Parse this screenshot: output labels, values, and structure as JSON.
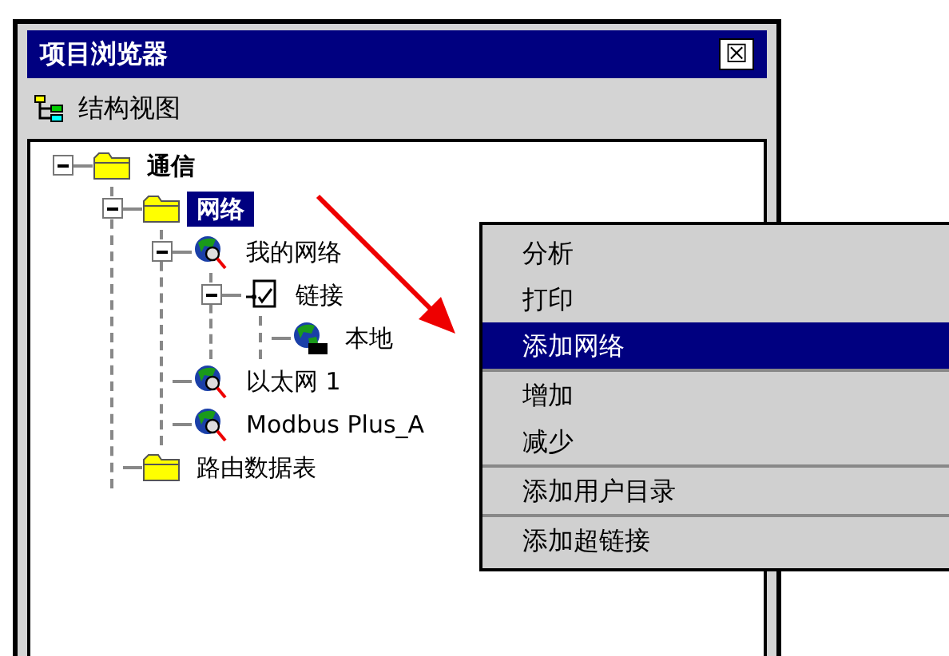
{
  "window": {
    "title": "项目浏览器",
    "close": "☒"
  },
  "toolbar": {
    "label": "结构视图"
  },
  "tree": [
    {
      "label": "通信",
      "kind": "folder",
      "expanded": true,
      "selected": false,
      "children": [
        {
          "label": "网络",
          "kind": "folder",
          "expanded": true,
          "selected": true,
          "children": [
            {
              "label": "我的网络",
              "kind": "network",
              "expanded": true,
              "selected": false,
              "children": [
                {
                  "label": "链接",
                  "kind": "link",
                  "expanded": true,
                  "selected": false,
                  "children": [
                    {
                      "label": "本地",
                      "kind": "local",
                      "selected": false
                    }
                  ]
                }
              ]
            },
            {
              "label": "以太网 1",
              "kind": "network",
              "selected": false
            },
            {
              "label": "Modbus Plus_A",
              "kind": "network",
              "selected": false
            }
          ]
        },
        {
          "label": "路由数据表",
          "kind": "folder",
          "selected": false
        }
      ]
    }
  ],
  "context_menu": {
    "groups": [
      [
        {
          "label": "分析",
          "selected": false
        },
        {
          "label": "打印",
          "selected": false
        },
        {
          "label": "添加网络",
          "selected": true
        }
      ],
      [
        {
          "label": "增加",
          "selected": false
        },
        {
          "label": "减少",
          "selected": false
        }
      ],
      [
        {
          "label": "添加用户目录",
          "selected": false
        }
      ],
      [
        {
          "label": "添加超链接",
          "selected": false
        }
      ]
    ]
  }
}
